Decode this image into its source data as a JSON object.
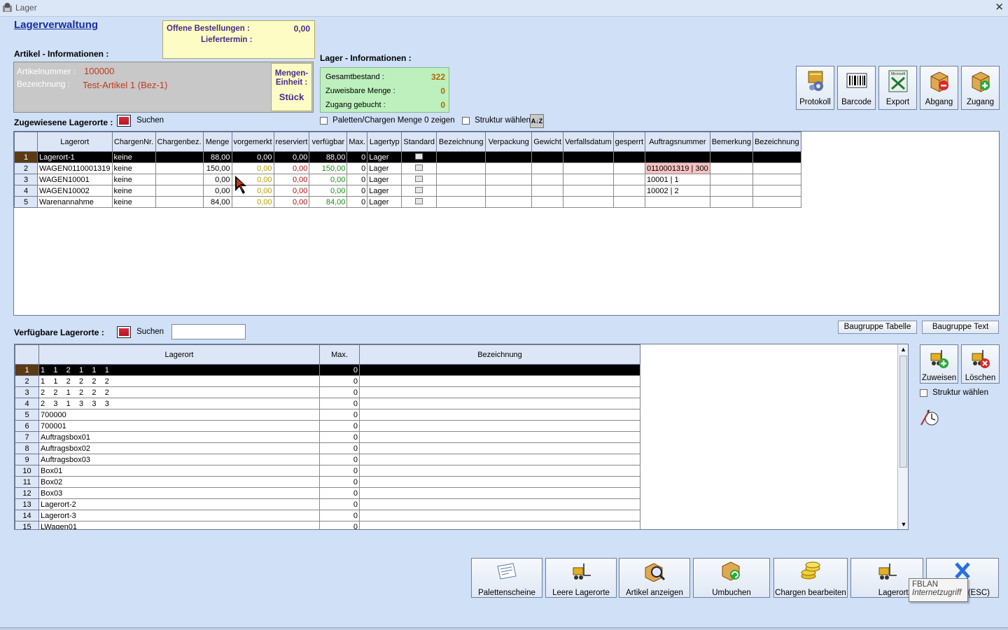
{
  "window": {
    "title": "Lager",
    "close_glyph": "✕"
  },
  "header": {
    "title": "Lagerverwaltung",
    "article_section": "Artikel - Informationen :",
    "stock_section": "Lager - Informationen :"
  },
  "orders": {
    "open_label": "Offene Bestellungen :",
    "open_value": "0,00",
    "delivery_label": "Liefertermin :",
    "delivery_value": ""
  },
  "article": {
    "number_label": "Artikelnummer :",
    "number_value": "100000",
    "desc_label": "Bezeichnung :",
    "desc_value": "Test-Artikel 1  (Bez-1)",
    "unit_label_1": "Mengen-",
    "unit_label_2": "Einheit :",
    "unit_value": "Stück"
  },
  "stock_info": {
    "total_label": "Gesamtbestand :",
    "total_value": "322",
    "assignable_label": "Zuweisbare Menge :",
    "assignable_value": "0",
    "booked_label": "Zugang gebucht :",
    "booked_value": "0"
  },
  "toolbar": {
    "protokoll": "Protokoll",
    "barcode": "Barcode",
    "export": "Export",
    "abgang": "Abgang",
    "zugang": "Zugang",
    "export_tag": "Microsoft"
  },
  "assigned": {
    "label": "Zugewiesene Lagerorte :",
    "search": "Suchen",
    "pallets_zero": "Paletten/Chargen Menge 0 zeigen",
    "structure": "Struktur wählen",
    "sort_glyph": "A↓Z",
    "columns": [
      "",
      "Lagerort",
      "ChargenNr.",
      "Chargenbez.",
      "Menge",
      "vorgemerkt",
      "reserviert",
      "verfügbar",
      "Max.",
      "Lagertyp",
      "Standard",
      "Bezeichnung",
      "Verpackung",
      "Gewicht",
      "Verfallsdatum",
      "gesperrt",
      "Auftragsnummer",
      "Bemerkung",
      "Bezeichnung"
    ],
    "rows": [
      {
        "n": "1",
        "lagerort": "Lagerort-1",
        "charge": "keine",
        "chargenbez": "",
        "menge": "88,00",
        "vorgemerkt": "0,00",
        "reserviert": "0,00",
        "verfuegbar": "88,00",
        "max": "0",
        "typ": "Lager",
        "auftrag": ""
      },
      {
        "n": "2",
        "lagerort": "WAGEN0110001319",
        "charge": "keine",
        "chargenbez": "",
        "menge": "150,00",
        "vorgemerkt": "0,00",
        "reserviert": "0,00",
        "verfuegbar": "150,00",
        "max": "0",
        "typ": "Lager",
        "auftrag": "0110001319 | 300"
      },
      {
        "n": "3",
        "lagerort": "WAGEN10001",
        "charge": "keine",
        "chargenbez": "",
        "menge": "0,00",
        "vorgemerkt": "0,00",
        "reserviert": "0,00",
        "verfuegbar": "0,00",
        "max": "0",
        "typ": "Lager",
        "auftrag": "10001 | 1"
      },
      {
        "n": "4",
        "lagerort": "WAGEN10002",
        "charge": "keine",
        "chargenbez": "",
        "menge": "0,00",
        "vorgemerkt": "0,00",
        "reserviert": "0,00",
        "verfuegbar": "0,00",
        "max": "0",
        "typ": "Lager",
        "auftrag": "10002 | 2"
      },
      {
        "n": "5",
        "lagerort": "Warenannahme",
        "charge": "keine",
        "chargenbez": "",
        "menge": "84,00",
        "vorgemerkt": "0,00",
        "reserviert": "0,00",
        "verfuegbar": "84,00",
        "max": "0",
        "typ": "Lager",
        "auftrag": ""
      }
    ]
  },
  "available": {
    "label": "Verfügbare Lagerorte :",
    "search": "Suchen",
    "search_value": "",
    "btn_table": "Baugruppe Tabelle",
    "btn_text": "Baugruppe Text",
    "columns": [
      "",
      "Lagerort",
      "Max.",
      "Bezeichnung"
    ],
    "rows": [
      {
        "n": "1",
        "lagerort": "1    1    2    1    1    1",
        "max": "0",
        "bez": ""
      },
      {
        "n": "2",
        "lagerort": "1    1    2    2    2    2",
        "max": "0",
        "bez": ""
      },
      {
        "n": "3",
        "lagerort": "2    2    1    2    2    2",
        "max": "0",
        "bez": ""
      },
      {
        "n": "4",
        "lagerort": "2    3    1    3    3    3",
        "max": "0",
        "bez": ""
      },
      {
        "n": "5",
        "lagerort": "700000",
        "max": "0",
        "bez": ""
      },
      {
        "n": "6",
        "lagerort": "700001",
        "max": "0",
        "bez": ""
      },
      {
        "n": "7",
        "lagerort": "Auftragsbox01",
        "max": "0",
        "bez": ""
      },
      {
        "n": "8",
        "lagerort": "Auftragsbox02",
        "max": "0",
        "bez": ""
      },
      {
        "n": "9",
        "lagerort": "Auftragsbox03",
        "max": "0",
        "bez": ""
      },
      {
        "n": "10",
        "lagerort": "Box01",
        "max": "0",
        "bez": ""
      },
      {
        "n": "11",
        "lagerort": "Box02",
        "max": "0",
        "bez": ""
      },
      {
        "n": "12",
        "lagerort": "Box03",
        "max": "0",
        "bez": ""
      },
      {
        "n": "13",
        "lagerort": "Lagerort-2",
        "max": "0",
        "bez": ""
      },
      {
        "n": "14",
        "lagerort": "Lagerort-3",
        "max": "0",
        "bez": ""
      },
      {
        "n": "15",
        "lagerort": "LWagen01",
        "max": "0",
        "bez": ""
      }
    ],
    "assign": "Zuweisen",
    "delete": "Löschen",
    "structure": "Struktur wählen"
  },
  "bottom": {
    "paletten": "Palettenscheine",
    "leere": "Leere Lagerorte",
    "artikel": "Artikel anzeigen",
    "umbuchen": "Umbuchen",
    "chargen": "Chargen bearbeiten",
    "lagerorte": "Lagerorte",
    "close": "(ESC)"
  },
  "tooltip": {
    "line1": "FBLAN",
    "line2": "Internetzugriff"
  },
  "icons": [
    "app-icon",
    "close-icon",
    "search-icon",
    "sort-icon",
    "protokoll-icon",
    "barcode-icon",
    "export-icon",
    "abgang-icon",
    "zugang-icon",
    "forklift-add-icon",
    "forklift-delete-icon",
    "cursor-icon",
    "pallet-note-icon",
    "forklift-icon",
    "magnifier-box-icon",
    "box-refresh-icon",
    "coins-icon",
    "red-x-icon"
  ]
}
